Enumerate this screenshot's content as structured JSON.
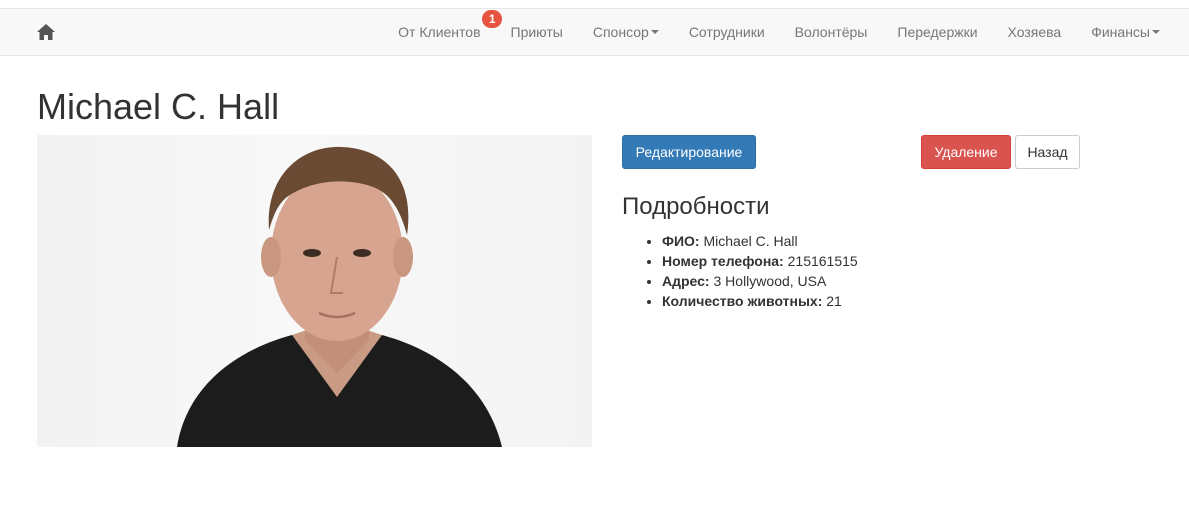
{
  "nav": {
    "home_icon": "home-icon",
    "items": [
      {
        "label": "От Клиентов",
        "badge": "1"
      },
      {
        "label": "Приюты"
      },
      {
        "label": "Спонсор",
        "dropdown": true
      },
      {
        "label": "Сотрудники"
      },
      {
        "label": "Волонтёры"
      },
      {
        "label": "Передержки"
      },
      {
        "label": "Хозяева"
      },
      {
        "label": "Финансы",
        "dropdown": true
      }
    ]
  },
  "page": {
    "title": "Michael C. Hall"
  },
  "actions": {
    "edit_label": "Редактирование",
    "delete_label": "Удаление",
    "back_label": "Назад"
  },
  "details": {
    "heading": "Подробности",
    "items": [
      {
        "label": "ФИО:",
        "value": "Michael C. Hall"
      },
      {
        "label": "Номер телефона:",
        "value": "215161515"
      },
      {
        "label": "Адрес:",
        "value": "3 Hollywood, USA"
      },
      {
        "label": "Количество животных:",
        "value": "21"
      }
    ]
  },
  "colors": {
    "primary": "#337ab7",
    "danger": "#d9534f",
    "badge": "#e8543f",
    "navbar_bg": "#f8f8f8"
  }
}
